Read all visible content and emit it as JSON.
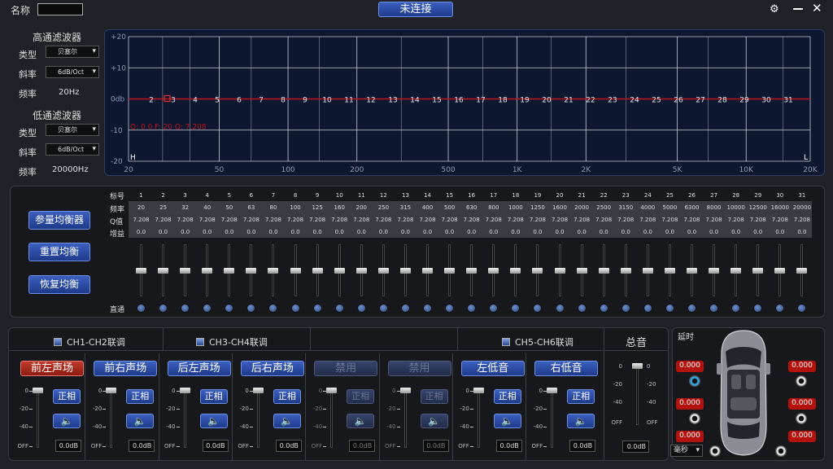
{
  "header": {
    "name_label": "名称",
    "name_value": "",
    "status_button": "未连接",
    "settings_icon": "gear-icon",
    "minimize_icon": "minimize-icon",
    "close_icon": "close-icon"
  },
  "highpass": {
    "title": "高通滤波器",
    "type_label": "类型",
    "type_value": "贝塞尔",
    "slope_label": "斜率",
    "slope_value": "6dB/Oct",
    "freq_label": "频率",
    "freq_value": "20Hz"
  },
  "lowpass": {
    "title": "低通滤波器",
    "type_label": "类型",
    "type_value": "贝塞尔",
    "slope_label": "斜率",
    "slope_value": "6dB/Oct",
    "freq_label": "频率",
    "freq_value": "20000Hz"
  },
  "graph": {
    "y_ticks": [
      "+20",
      "+10",
      "0db",
      "-10",
      "-20"
    ],
    "x_ticks": [
      "20",
      "50",
      "100",
      "200",
      "500",
      "1K",
      "2K",
      "5K",
      "10K",
      "20K"
    ],
    "band_markers": [
      "2",
      "3",
      "4",
      "5",
      "6",
      "7",
      "8",
      "9",
      "10",
      "11",
      "12",
      "13",
      "14",
      "15",
      "16",
      "17",
      "18",
      "19",
      "20",
      "21",
      "22",
      "23",
      "24",
      "25",
      "26",
      "27",
      "28",
      "29",
      "30",
      "31"
    ],
    "readout": "Q: 0.0  F: 20  Q: 7.208",
    "h_label": "H",
    "l_label": "L"
  },
  "eq": {
    "buttons": [
      "参量均衡器",
      "重置均衡",
      "恢复均衡"
    ],
    "row_labels": [
      "标号",
      "频率",
      "Q值",
      "增益"
    ],
    "bypass_label": "直通",
    "bands": [
      "1",
      "2",
      "3",
      "4",
      "5",
      "6",
      "7",
      "8",
      "9",
      "10",
      "11",
      "12",
      "13",
      "14",
      "15",
      "16",
      "17",
      "18",
      "19",
      "20",
      "21",
      "22",
      "23",
      "24",
      "25",
      "26",
      "27",
      "28",
      "29",
      "30",
      "31"
    ],
    "freqs": [
      "20",
      "25",
      "32",
      "40",
      "50",
      "63",
      "80",
      "100",
      "125",
      "160",
      "200",
      "250",
      "315",
      "400",
      "500",
      "630",
      "800",
      "1000",
      "1250",
      "1600",
      "2000",
      "2500",
      "3150",
      "4000",
      "5000",
      "6300",
      "8000",
      "10000",
      "12500",
      "16000",
      "20000"
    ],
    "q": "7.208",
    "gain": "0.0"
  },
  "channels": {
    "link_labels": [
      "CH1-CH2联调",
      "CH3-CH4联调",
      "CH5-CH6联调"
    ],
    "names": [
      "前左声场",
      "前右声场",
      "后左声场",
      "后右声场",
      "禁用",
      "禁用",
      "左低音",
      "右低音"
    ],
    "phase_label": "正相",
    "value": "0.0dB",
    "scale": [
      "0",
      "-20",
      "-40",
      "OFF"
    ],
    "master_title": "总音",
    "master_value": "0.0dB",
    "master_scale_left": [
      "0",
      "-20",
      "-40",
      "OFF"
    ],
    "master_scale_right": [
      "0",
      "-20",
      "-40",
      "OFF"
    ]
  },
  "delay": {
    "title": "延时",
    "values": [
      "0.000",
      "0.000",
      "0.000",
      "0.000",
      "0.000",
      "0.000"
    ],
    "unit": "毫秒"
  }
}
